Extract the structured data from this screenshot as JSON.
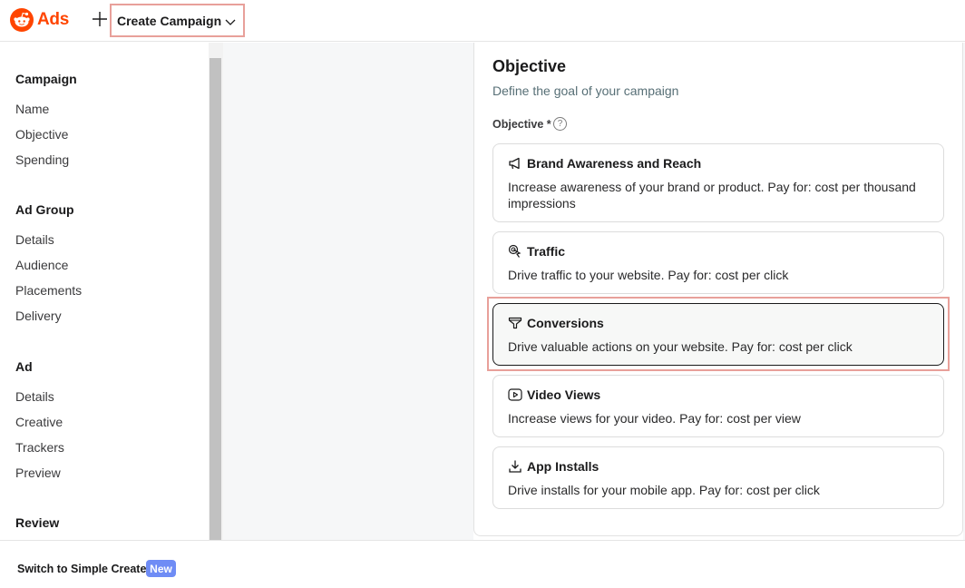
{
  "header": {
    "brand": "Ads",
    "create_label": "Create Campaign"
  },
  "sidebar": {
    "sections": [
      {
        "title": "Campaign",
        "items": [
          "Name",
          "Objective",
          "Spending"
        ]
      },
      {
        "title": "Ad Group",
        "items": [
          "Details",
          "Audience",
          "Placements",
          "Delivery"
        ]
      },
      {
        "title": "Ad",
        "items": [
          "Details",
          "Creative",
          "Trackers",
          "Preview"
        ]
      },
      {
        "title": "Review",
        "items": []
      }
    ]
  },
  "objective": {
    "title": "Objective",
    "subtitle": "Define the goal of your campaign",
    "field_label": "Objective *",
    "help_glyph": "?",
    "options": [
      {
        "title": "Brand Awareness and Reach",
        "desc": "Increase awareness of your brand or product. Pay for: cost per thousand impressions",
        "icon": "megaphone-icon",
        "selected": false
      },
      {
        "title": "Traffic",
        "desc": "Drive traffic to your website. Pay for: cost per click",
        "icon": "cursor-click-icon",
        "selected": false
      },
      {
        "title": "Conversions",
        "desc": "Drive valuable actions on your website. Pay for: cost per click",
        "icon": "funnel-icon",
        "selected": true
      },
      {
        "title": "Video Views",
        "desc": "Increase views for your video. Pay for: cost per view",
        "icon": "play-icon",
        "selected": false
      },
      {
        "title": "App Installs",
        "desc": "Drive installs for your mobile app. Pay for: cost per click",
        "icon": "download-icon",
        "selected": false
      }
    ]
  },
  "footer": {
    "switch_label": "Switch to Simple Create",
    "badge": "New"
  },
  "colors": {
    "brand": "#ff4500",
    "highlight": "#e8a09a",
    "badge": "#6f8cf5"
  }
}
